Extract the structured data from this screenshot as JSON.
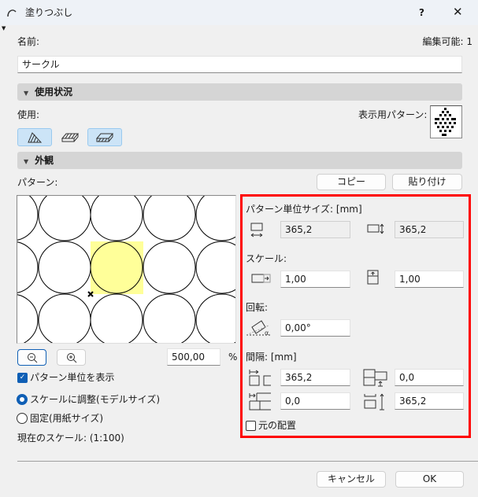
{
  "window": {
    "title": "塗りつぶし",
    "help": "?",
    "close": "✕"
  },
  "name": {
    "label": "名前:",
    "value": "サークル",
    "editable_label": "編集可能: 1"
  },
  "usage": {
    "section_title": "使用状況",
    "use_label": "使用:",
    "display_pattern_label": "表示用パターン:",
    "buttons": [
      {
        "name": "cut-fill",
        "selected": true
      },
      {
        "name": "cover-fill",
        "selected": false
      },
      {
        "name": "drafting-fill",
        "selected": true
      }
    ]
  },
  "appearance": {
    "section_title": "外観",
    "pattern_label": "パターン:",
    "copy": "コピー",
    "paste": "貼り付け"
  },
  "preview": {
    "zoom_value": "500,00",
    "zoom_unit": "%",
    "show_unit_label": "パターン単位を表示",
    "show_unit_checked": true,
    "radio_scale": "スケールに調整(モデルサイズ)",
    "radio_fixed": "固定(用紙サイズ)",
    "radio_selected": "scale",
    "current_scale": "現在のスケール: (1:100)"
  },
  "params": {
    "unit_size_label": "パターン単位サイズ: [mm]",
    "unit_width": "365,2",
    "unit_height": "365,2",
    "scale_label": "スケール:",
    "scale_x": "1,00",
    "scale_y": "1,00",
    "rotation_label": "回転:",
    "rotation": "0,00°",
    "spacing_label": "間隔: [mm]",
    "spacing_h": "365,2",
    "offset_v": "0,0",
    "offset_h": "0,0",
    "spacing_v": "365,2",
    "original_placement_label": "元の配置",
    "original_placement_checked": false
  },
  "footer": {
    "cancel": "キャンセル",
    "ok": "OK"
  },
  "colors": {
    "highlight": "#ff0000",
    "selection": "#ffff99",
    "accent": "#0f5fb5"
  }
}
